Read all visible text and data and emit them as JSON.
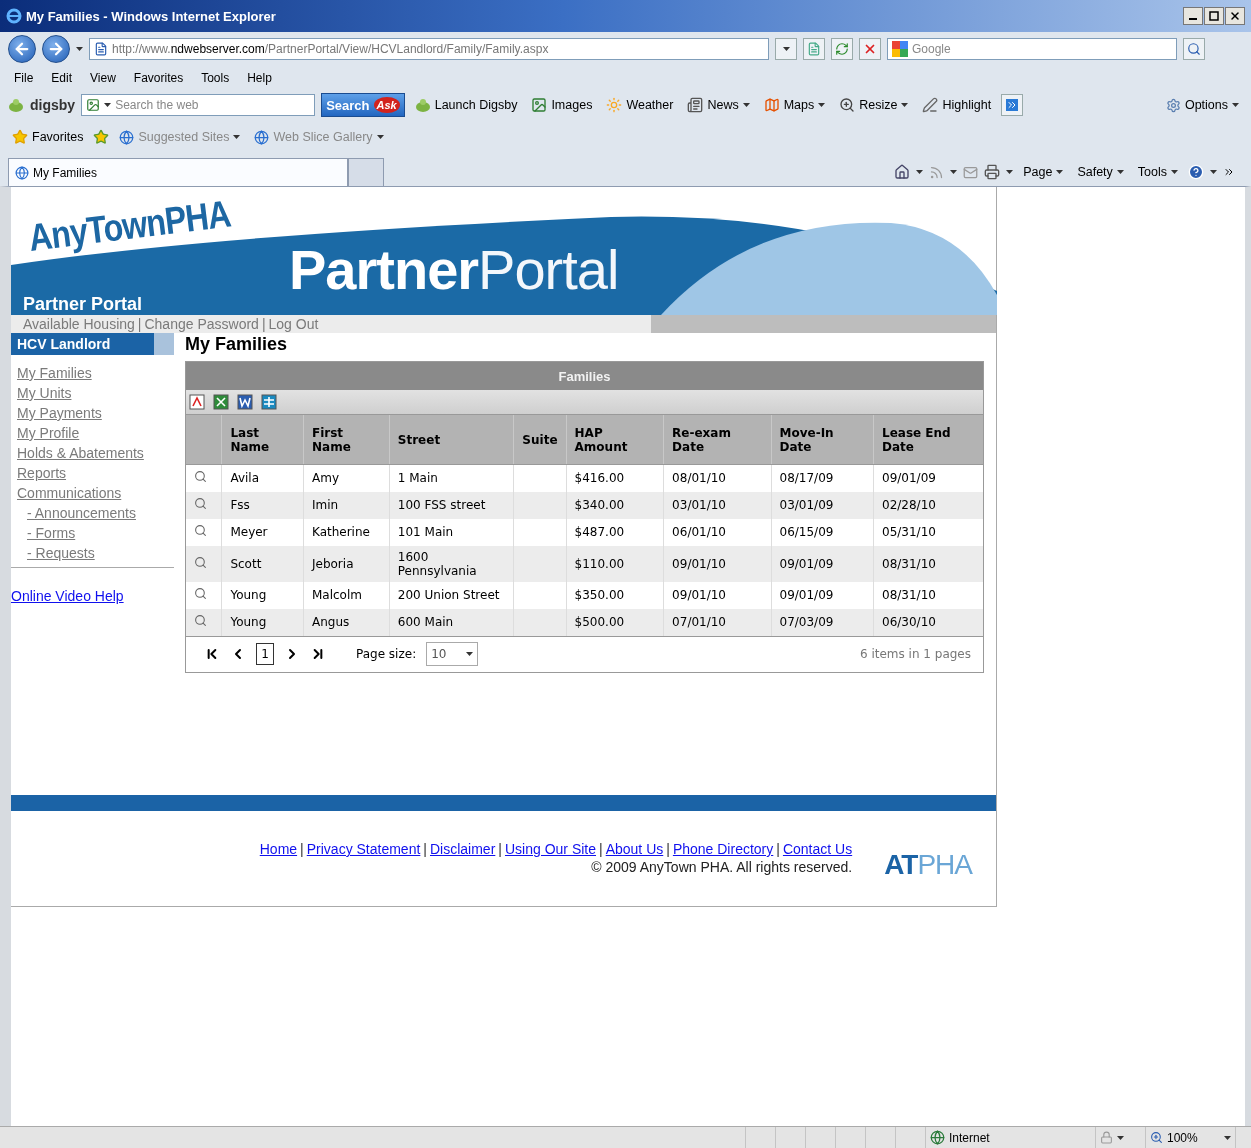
{
  "window": {
    "title": "My Families - Windows Internet Explorer"
  },
  "address_bar": {
    "url_prefix": "http://www.",
    "url_domain": "ndwebserver.com",
    "url_path": "/PartnerPortal/View/HCVLandlord/Family/Family.aspx",
    "search_placeholder": "Google"
  },
  "menu": [
    "File",
    "Edit",
    "View",
    "Favorites",
    "Tools",
    "Help"
  ],
  "digsby_toolbar": {
    "brand": "digsby",
    "search_placeholder": "Search the web",
    "search_button": "Search",
    "ask_logo": "Ask",
    "items": [
      {
        "kind": "digsby",
        "label": "Launch Digsby",
        "dropdown": false
      },
      {
        "kind": "images",
        "label": "Images",
        "dropdown": false
      },
      {
        "kind": "weather",
        "label": "Weather",
        "dropdown": false
      },
      {
        "kind": "news",
        "label": "News",
        "dropdown": true
      },
      {
        "kind": "maps",
        "label": "Maps",
        "dropdown": true
      },
      {
        "kind": "resize",
        "label": "Resize",
        "dropdown": true
      },
      {
        "kind": "highlight",
        "label": "Highlight",
        "dropdown": false
      }
    ],
    "options": "Options"
  },
  "favorites_bar": {
    "label": "Favorites",
    "items": [
      {
        "label": "Suggested Sites",
        "dropdown": true
      },
      {
        "label": "Web Slice Gallery",
        "dropdown": true
      }
    ]
  },
  "tabs": [
    {
      "label": "My Families",
      "selected": true
    }
  ],
  "command_bar": [
    "Page",
    "Safety",
    "Tools"
  ],
  "page": {
    "logo": "AnyTownPHA",
    "site_name": "Partner Portal",
    "banner_bold": "Partner",
    "banner_light": "Portal",
    "top_links": [
      "Available Housing",
      "Change Password",
      "Log Out"
    ],
    "top_links_separator": "|",
    "sidebar": {
      "title": "HCV Landlord",
      "items": [
        {
          "label": "My Families"
        },
        {
          "label": "My Units"
        },
        {
          "label": "My Payments"
        },
        {
          "label": "My Profile"
        },
        {
          "label": "Holds & Abatements"
        },
        {
          "label": "Reports"
        },
        {
          "label": "Communications",
          "children": [
            {
              "label": "- Announcements"
            },
            {
              "label": "- Forms"
            },
            {
              "label": "- Requests"
            }
          ]
        }
      ],
      "help_link": "Online Video Help"
    },
    "heading": "My Families",
    "grid": {
      "title": "Families",
      "columns": [
        "Last Name",
        "First Name",
        "Street",
        "Suite",
        "HAP Amount",
        "Re-exam Date",
        "Move-In Date",
        "Lease End Date"
      ],
      "rows": [
        {
          "last_name": "Avila",
          "first_name": "Amy",
          "street": "1 Main",
          "hap_amount": "$416.00",
          "reexam_date": "08/01/10",
          "move_in_date": "08/17/09",
          "lease_end_date": "09/01/09"
        },
        {
          "last_name": "Fss",
          "first_name": "Imin",
          "street": "100 FSS street",
          "hap_amount": "$340.00",
          "reexam_date": "03/01/10",
          "move_in_date": "03/01/09",
          "lease_end_date": "02/28/10"
        },
        {
          "last_name": "Meyer",
          "first_name": "Katherine",
          "street": "101 Main",
          "hap_amount": "$487.00",
          "reexam_date": "06/01/10",
          "move_in_date": "06/15/09",
          "lease_end_date": "05/31/10"
        },
        {
          "last_name": "Scott",
          "first_name": "Jeboria",
          "street": "1600 Pennsylvania",
          "hap_amount": "$110.00",
          "reexam_date": "09/01/10",
          "move_in_date": "09/01/09",
          "lease_end_date": "08/31/10"
        },
        {
          "last_name": "Young",
          "first_name": "Malcolm",
          "street": "200 Union Street",
          "hap_amount": "$350.00",
          "reexam_date": "09/01/10",
          "move_in_date": "09/01/09",
          "lease_end_date": "08/31/10"
        },
        {
          "last_name": "Young",
          "first_name": "Angus",
          "street": "600 Main",
          "hap_amount": "$500.00",
          "reexam_date": "07/01/10",
          "move_in_date": "07/03/09",
          "lease_end_date": "06/30/10"
        }
      ],
      "pager": {
        "page": "1",
        "page_size_label": "Page size:",
        "page_size": "10",
        "summary": "6 items in 1 pages"
      }
    },
    "footer": {
      "links": [
        "Home",
        "Privacy Statement",
        "Disclaimer",
        "Using Our Site",
        "About Us",
        "Phone Directory",
        "Contact Us"
      ],
      "separator": "|",
      "copyright": "© 2009 AnyTown PHA. All rights reserved.",
      "logo_bold": "AT",
      "logo_light": "PHA"
    }
  },
  "status_bar": {
    "zone": "Internet",
    "zoom": "100%"
  }
}
